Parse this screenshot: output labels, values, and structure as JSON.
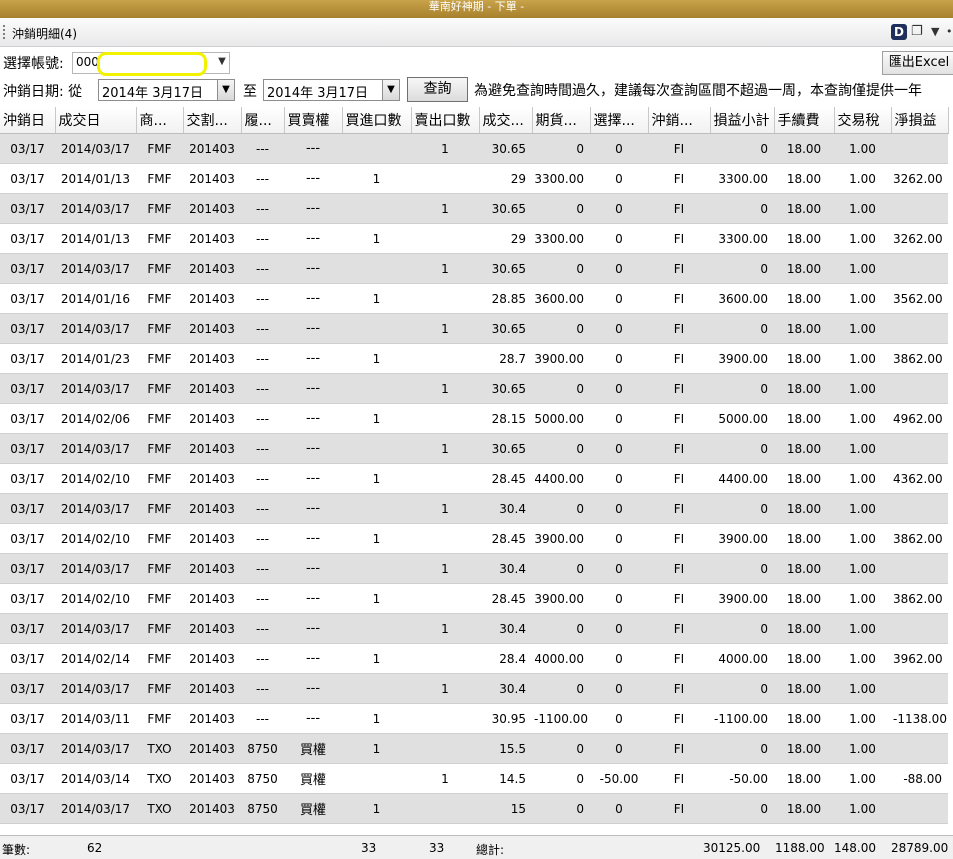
{
  "window": {
    "title": "華南好神期 - 下單 -"
  },
  "tab": {
    "title": "沖銷明細(4)",
    "d_label": "D"
  },
  "filters": {
    "account_label": "選擇帳號:",
    "account_value": "000",
    "export_label": "匯出Excel",
    "date_label": "沖銷日期: 從",
    "date_from": "2014年  3月17日",
    "to_label": "至",
    "date_to": "2014年  3月17日",
    "query_label": "查詢",
    "notice": "為避免查詢時間過久，建議每次查詢區間不超過一周，本查詢僅提供一年"
  },
  "columns": [
    "沖銷日",
    "成交日",
    "商...",
    "交割...",
    "履...",
    "買賣權",
    "買進口數",
    "賣出口數",
    "成交...",
    "期貨...",
    "選擇...",
    "沖銷...",
    "損益小計",
    "手續費",
    "交易稅",
    "淨損益"
  ],
  "rows": [
    [
      "03/17",
      "2014/03/17",
      "FMF",
      "201403",
      "---",
      "---",
      "",
      "1",
      "30.65",
      "0",
      "0",
      "FI",
      "0",
      "18.00",
      "1.00",
      ""
    ],
    [
      "03/17",
      "2014/01/13",
      "FMF",
      "201403",
      "---",
      "---",
      "1",
      "",
      "29",
      "3300.00",
      "0",
      "FI",
      "3300.00",
      "18.00",
      "1.00",
      "3262.00"
    ],
    [
      "03/17",
      "2014/03/17",
      "FMF",
      "201403",
      "---",
      "---",
      "",
      "1",
      "30.65",
      "0",
      "0",
      "FI",
      "0",
      "18.00",
      "1.00",
      ""
    ],
    [
      "03/17",
      "2014/01/13",
      "FMF",
      "201403",
      "---",
      "---",
      "1",
      "",
      "29",
      "3300.00",
      "0",
      "FI",
      "3300.00",
      "18.00",
      "1.00",
      "3262.00"
    ],
    [
      "03/17",
      "2014/03/17",
      "FMF",
      "201403",
      "---",
      "---",
      "",
      "1",
      "30.65",
      "0",
      "0",
      "FI",
      "0",
      "18.00",
      "1.00",
      ""
    ],
    [
      "03/17",
      "2014/01/16",
      "FMF",
      "201403",
      "---",
      "---",
      "1",
      "",
      "28.85",
      "3600.00",
      "0",
      "FI",
      "3600.00",
      "18.00",
      "1.00",
      "3562.00"
    ],
    [
      "03/17",
      "2014/03/17",
      "FMF",
      "201403",
      "---",
      "---",
      "",
      "1",
      "30.65",
      "0",
      "0",
      "FI",
      "0",
      "18.00",
      "1.00",
      ""
    ],
    [
      "03/17",
      "2014/01/23",
      "FMF",
      "201403",
      "---",
      "---",
      "1",
      "",
      "28.7",
      "3900.00",
      "0",
      "FI",
      "3900.00",
      "18.00",
      "1.00",
      "3862.00"
    ],
    [
      "03/17",
      "2014/03/17",
      "FMF",
      "201403",
      "---",
      "---",
      "",
      "1",
      "30.65",
      "0",
      "0",
      "FI",
      "0",
      "18.00",
      "1.00",
      ""
    ],
    [
      "03/17",
      "2014/02/06",
      "FMF",
      "201403",
      "---",
      "---",
      "1",
      "",
      "28.15",
      "5000.00",
      "0",
      "FI",
      "5000.00",
      "18.00",
      "1.00",
      "4962.00"
    ],
    [
      "03/17",
      "2014/03/17",
      "FMF",
      "201403",
      "---",
      "---",
      "",
      "1",
      "30.65",
      "0",
      "0",
      "FI",
      "0",
      "18.00",
      "1.00",
      ""
    ],
    [
      "03/17",
      "2014/02/10",
      "FMF",
      "201403",
      "---",
      "---",
      "1",
      "",
      "28.45",
      "4400.00",
      "0",
      "FI",
      "4400.00",
      "18.00",
      "1.00",
      "4362.00"
    ],
    [
      "03/17",
      "2014/03/17",
      "FMF",
      "201403",
      "---",
      "---",
      "",
      "1",
      "30.4",
      "0",
      "0",
      "FI",
      "0",
      "18.00",
      "1.00",
      ""
    ],
    [
      "03/17",
      "2014/02/10",
      "FMF",
      "201403",
      "---",
      "---",
      "1",
      "",
      "28.45",
      "3900.00",
      "0",
      "FI",
      "3900.00",
      "18.00",
      "1.00",
      "3862.00"
    ],
    [
      "03/17",
      "2014/03/17",
      "FMF",
      "201403",
      "---",
      "---",
      "",
      "1",
      "30.4",
      "0",
      "0",
      "FI",
      "0",
      "18.00",
      "1.00",
      ""
    ],
    [
      "03/17",
      "2014/02/10",
      "FMF",
      "201403",
      "---",
      "---",
      "1",
      "",
      "28.45",
      "3900.00",
      "0",
      "FI",
      "3900.00",
      "18.00",
      "1.00",
      "3862.00"
    ],
    [
      "03/17",
      "2014/03/17",
      "FMF",
      "201403",
      "---",
      "---",
      "",
      "1",
      "30.4",
      "0",
      "0",
      "FI",
      "0",
      "18.00",
      "1.00",
      ""
    ],
    [
      "03/17",
      "2014/02/14",
      "FMF",
      "201403",
      "---",
      "---",
      "1",
      "",
      "28.4",
      "4000.00",
      "0",
      "FI",
      "4000.00",
      "18.00",
      "1.00",
      "3962.00"
    ],
    [
      "03/17",
      "2014/03/17",
      "FMF",
      "201403",
      "---",
      "---",
      "",
      "1",
      "30.4",
      "0",
      "0",
      "FI",
      "0",
      "18.00",
      "1.00",
      ""
    ],
    [
      "03/17",
      "2014/03/11",
      "FMF",
      "201403",
      "---",
      "---",
      "1",
      "",
      "30.95",
      "-1100.00",
      "0",
      "FI",
      "-1100.00",
      "18.00",
      "1.00",
      "-1138.00"
    ],
    [
      "03/17",
      "2014/03/17",
      "TXO",
      "201403",
      "8750",
      "買權",
      "1",
      "",
      "15.5",
      "0",
      "0",
      "FI",
      "0",
      "18.00",
      "1.00",
      ""
    ],
    [
      "03/17",
      "2014/03/14",
      "TXO",
      "201403",
      "8750",
      "買權",
      "",
      "1",
      "14.5",
      "0",
      "-50.00",
      "FI",
      "-50.00",
      "18.00",
      "1.00",
      "-88.00"
    ],
    [
      "03/17",
      "2014/03/17",
      "TXO",
      "201403",
      "8750",
      "買權",
      "1",
      "",
      "15",
      "0",
      "0",
      "FI",
      "0",
      "18.00",
      "1.00",
      ""
    ]
  ],
  "footer": {
    "count_label": "筆數:",
    "count": "62",
    "buy_total": "33",
    "sell_total": "33",
    "total_label": "總計:",
    "pnl_total": "30125.00",
    "fee_total": "1188.00",
    "tax_total": "148.00",
    "net_total": "28789.00"
  }
}
